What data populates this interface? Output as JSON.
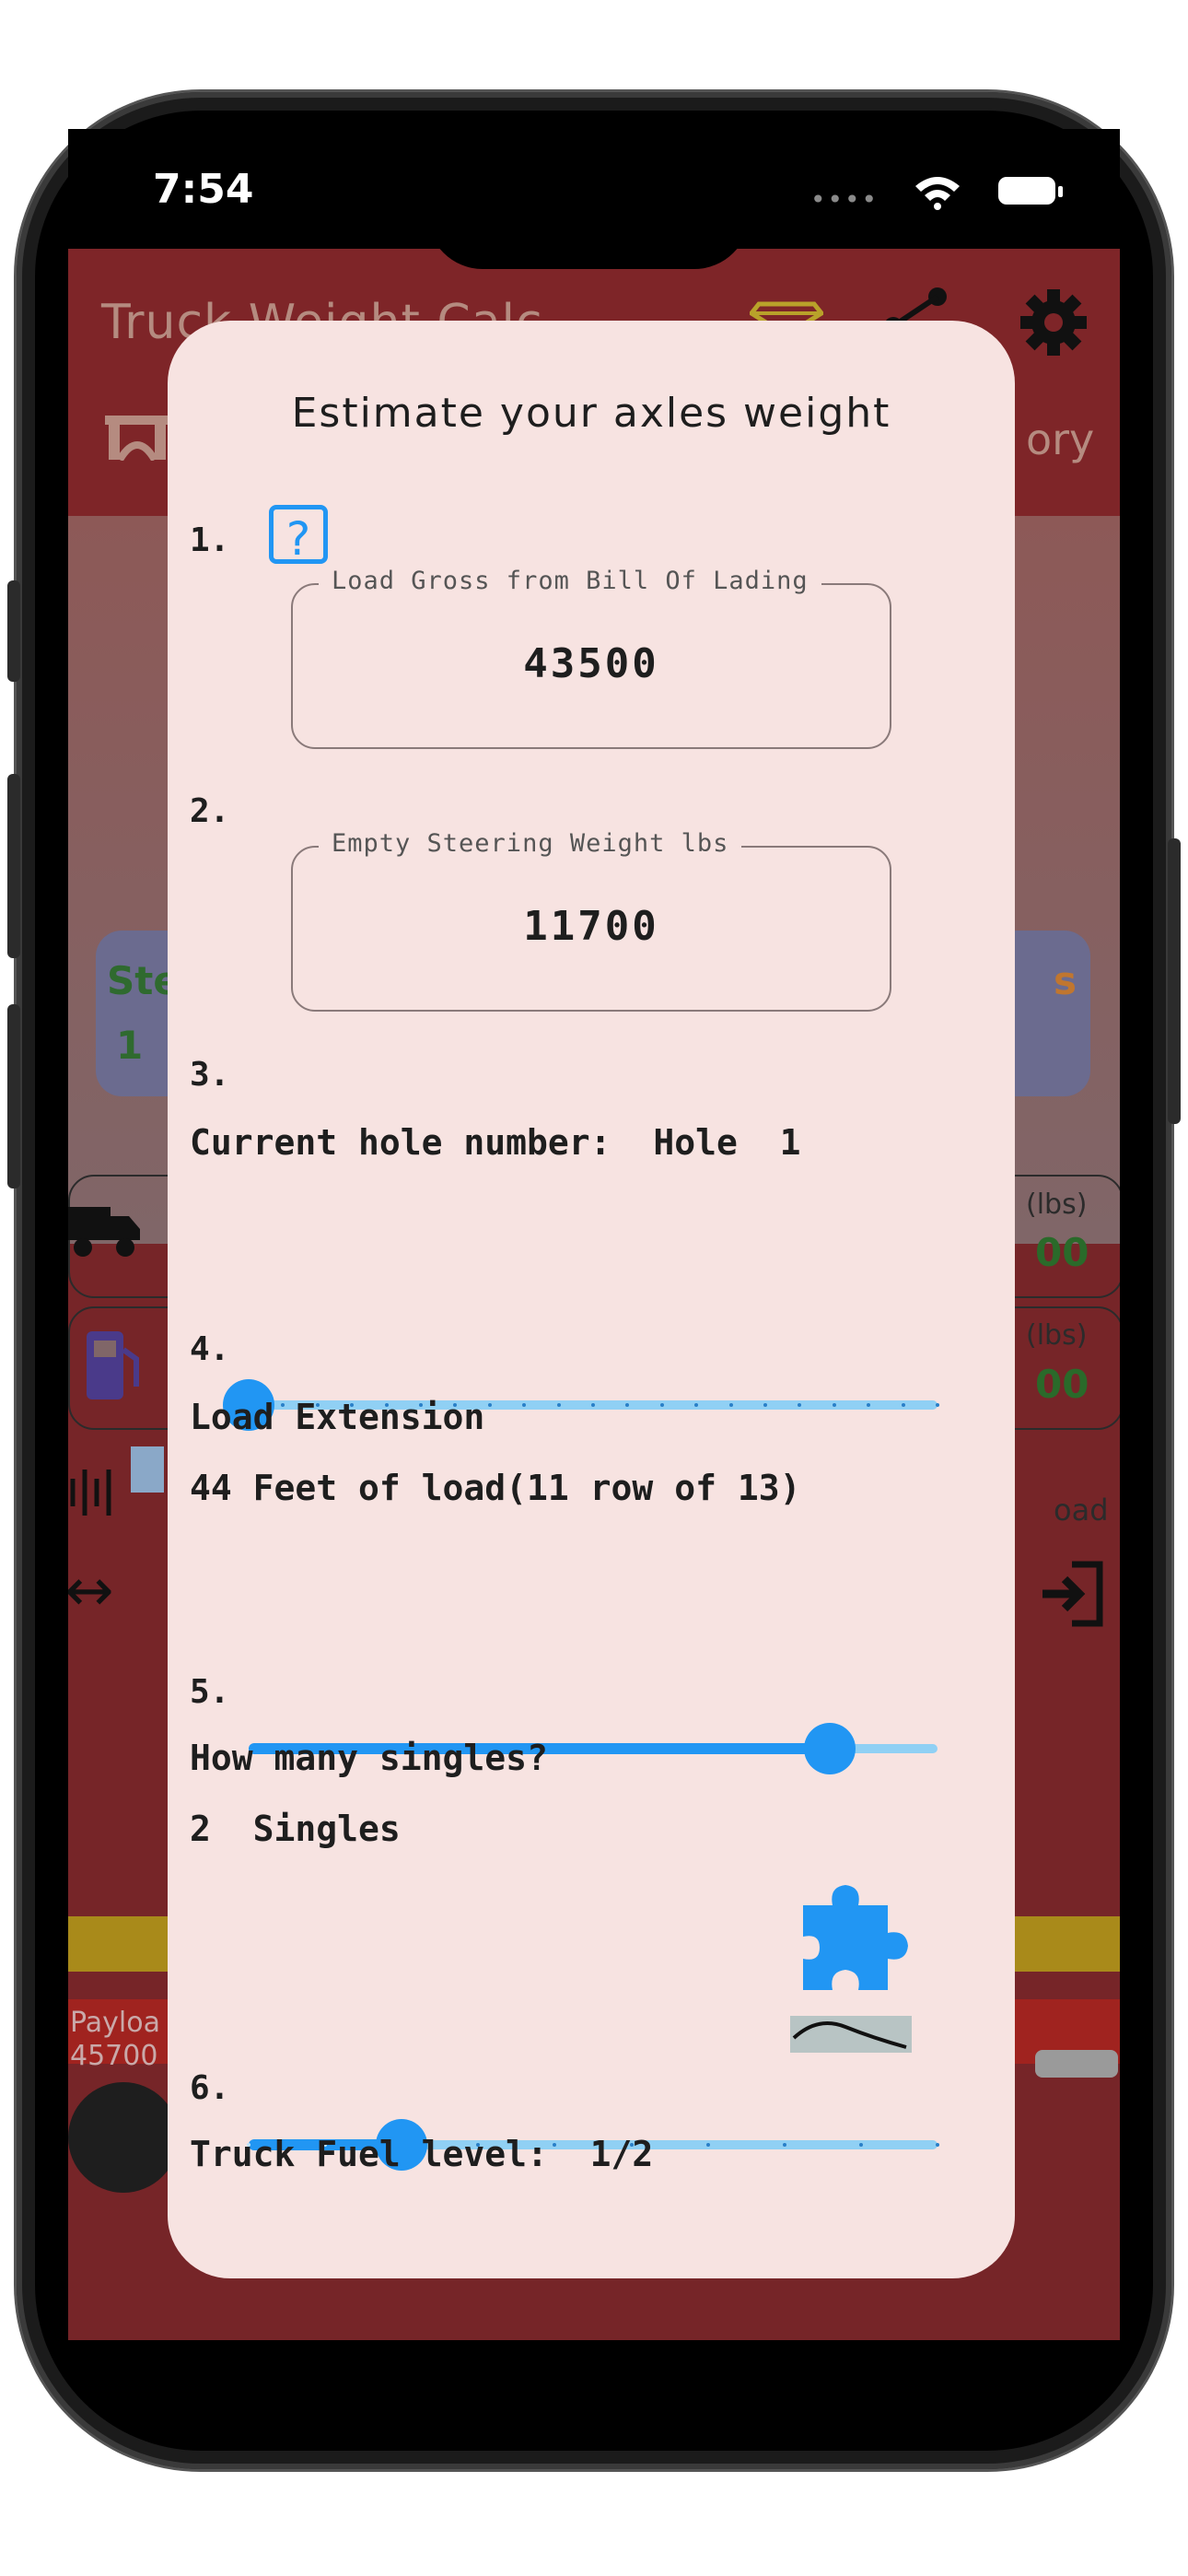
{
  "status": {
    "time": "7:54",
    "dots": "••••"
  },
  "app": {
    "title": "Truck Weight Calc",
    "nav_right": "ory",
    "steer_left": "Ste",
    "steer_left_value": "1",
    "steer_right": "s",
    "row1_label": "(lbs)",
    "row1_value": "00",
    "row2_label": "(lbs)",
    "row2_value": "00",
    "load_label": "oad",
    "payload_label": "Payloa",
    "payload_value": "45700"
  },
  "dialog": {
    "title": "Estimate your axles weight",
    "step1": {
      "num": "1.",
      "help": "?",
      "field_label": "Load Gross from Bill Of Lading",
      "field_value": "43500"
    },
    "step2": {
      "num": "2.",
      "field_label": "Empty Steering Weight lbs",
      "field_value": "11700"
    },
    "step3": {
      "num": "3.",
      "label": "Current hole number:  Hole  1",
      "slider": {
        "value": 1,
        "min": 1,
        "max": 21
      }
    },
    "step4": {
      "num": "4.",
      "label": "Load Extension",
      "value_text": "44 Feet of load(11 row of 13)",
      "slider": {
        "fraction": 0.843
      }
    },
    "step5": {
      "num": "5.",
      "label": "How many singles?",
      "value_text": "2  Singles",
      "slider": {
        "value": 2,
        "min": 0,
        "max": 9
      }
    },
    "step6": {
      "num": "6.",
      "label": "Truck Fuel level:  1/2",
      "slider": {
        "fraction": 0.5
      }
    }
  },
  "colors": {
    "accent": "#2196f3",
    "track_inactive": "#90d0f4",
    "dialog_bg": "#f7e3e1",
    "app_bg": "#762528"
  }
}
